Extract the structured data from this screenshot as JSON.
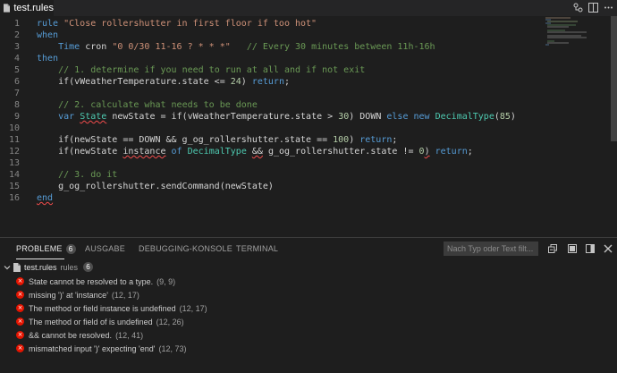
{
  "tab": {
    "title": "test.rules"
  },
  "editor": {
    "lines": [
      {
        "n": "1",
        "tokens": [
          {
            "t": "rule ",
            "c": "kw"
          },
          {
            "t": "\"Close rollershutter in first floor if too hot\"",
            "c": "str"
          }
        ]
      },
      {
        "n": "2",
        "tokens": [
          {
            "t": "when",
            "c": "kw"
          }
        ]
      },
      {
        "n": "3",
        "tokens": [
          {
            "t": "    ",
            "c": "pl"
          },
          {
            "t": "Time",
            "c": "kw"
          },
          {
            "t": " cron ",
            "c": "pl"
          },
          {
            "t": "\"0 0/30 11-16 ? * * *\"",
            "c": "str"
          },
          {
            "t": "   // Every 30 minutes between 11h-16h",
            "c": "cm"
          }
        ]
      },
      {
        "n": "4",
        "tokens": [
          {
            "t": "then",
            "c": "kw"
          }
        ]
      },
      {
        "n": "5",
        "tokens": [
          {
            "t": "    ",
            "c": "pl"
          },
          {
            "t": "// 1. determine if you need to run at all and if not exit",
            "c": "cm"
          }
        ]
      },
      {
        "n": "6",
        "tokens": [
          {
            "t": "    if(vWeatherTemperature.state <= ",
            "c": "pl"
          },
          {
            "t": "24",
            "c": "num"
          },
          {
            "t": ") ",
            "c": "pl"
          },
          {
            "t": "return",
            "c": "kw"
          },
          {
            "t": ";",
            "c": "pl"
          }
        ]
      },
      {
        "n": "7",
        "tokens": []
      },
      {
        "n": "8",
        "tokens": [
          {
            "t": "    ",
            "c": "pl"
          },
          {
            "t": "// 2. calculate what needs to be done",
            "c": "cm"
          }
        ]
      },
      {
        "n": "9",
        "tokens": [
          {
            "t": "    ",
            "c": "pl"
          },
          {
            "t": "var",
            "c": "kw"
          },
          {
            "t": " ",
            "c": "pl"
          },
          {
            "t": "State",
            "c": "ty err"
          },
          {
            "t": " newState = if(vWeatherTemperature.state > ",
            "c": "pl"
          },
          {
            "t": "30",
            "c": "num"
          },
          {
            "t": ") DOWN ",
            "c": "pl"
          },
          {
            "t": "else",
            "c": "kw"
          },
          {
            "t": " ",
            "c": "pl"
          },
          {
            "t": "new",
            "c": "kw"
          },
          {
            "t": " ",
            "c": "pl"
          },
          {
            "t": "DecimalType",
            "c": "ty"
          },
          {
            "t": "(",
            "c": "pl"
          },
          {
            "t": "85",
            "c": "num"
          },
          {
            "t": ")",
            "c": "pl"
          }
        ]
      },
      {
        "n": "10",
        "tokens": []
      },
      {
        "n": "11",
        "tokens": [
          {
            "t": "    if(newState == DOWN && g_og_rollershutter.state == ",
            "c": "pl"
          },
          {
            "t": "100",
            "c": "num"
          },
          {
            "t": ") ",
            "c": "pl"
          },
          {
            "t": "return",
            "c": "kw"
          },
          {
            "t": ";",
            "c": "pl"
          }
        ]
      },
      {
        "n": "12",
        "tokens": [
          {
            "t": "    if(newState ",
            "c": "pl"
          },
          {
            "t": "instance",
            "c": "pl err"
          },
          {
            "t": " ",
            "c": "pl"
          },
          {
            "t": "of",
            "c": "kw"
          },
          {
            "t": " ",
            "c": "pl"
          },
          {
            "t": "DecimalType",
            "c": "ty"
          },
          {
            "t": " ",
            "c": "pl"
          },
          {
            "t": "&&",
            "c": "pl err"
          },
          {
            "t": " g_og_rollershutter.state != ",
            "c": "pl"
          },
          {
            "t": "0",
            "c": "num"
          },
          {
            "t": ")",
            "c": "pl err"
          },
          {
            "t": " ",
            "c": "pl"
          },
          {
            "t": "return",
            "c": "kw"
          },
          {
            "t": ";",
            "c": "pl"
          }
        ]
      },
      {
        "n": "13",
        "tokens": []
      },
      {
        "n": "14",
        "tokens": [
          {
            "t": "    ",
            "c": "pl"
          },
          {
            "t": "// 3. do it",
            "c": "cm"
          }
        ]
      },
      {
        "n": "15",
        "tokens": [
          {
            "t": "    g_og_rollershutter.sendCommand(newState)",
            "c": "pl"
          }
        ]
      },
      {
        "n": "16",
        "tokens": [
          {
            "t": "end",
            "c": "kw err"
          }
        ]
      }
    ]
  },
  "panel": {
    "tabs": [
      {
        "label": "PROBLEME",
        "count": "6"
      },
      {
        "label": "AUSGABE"
      },
      {
        "label": "DEBUGGING-KONSOLE"
      },
      {
        "label": "TERMINAL"
      }
    ],
    "filter_placeholder": "Nach Typ oder Text filt...",
    "root": {
      "name": "test.rules",
      "desc": "rules",
      "count": "6"
    },
    "problems": [
      {
        "message": "State cannot be resolved to a type.",
        "location": "(9, 9)"
      },
      {
        "message": "missing ')' at 'instance'",
        "location": "(12, 17)"
      },
      {
        "message": "The method or field instance is undefined",
        "location": "(12, 17)"
      },
      {
        "message": "The method or field of is undefined",
        "location": "(12, 26)"
      },
      {
        "message": "&& cannot be resolved.",
        "location": "(12, 41)"
      },
      {
        "message": "mismatched input ')' expecting 'end'",
        "location": "(12, 73)"
      }
    ]
  },
  "colors": {
    "keyword": "#569cd6",
    "string": "#ce9178",
    "comment": "#6a9955",
    "number": "#b5cea8",
    "type": "#4ec9b0",
    "error": "#e51400"
  }
}
